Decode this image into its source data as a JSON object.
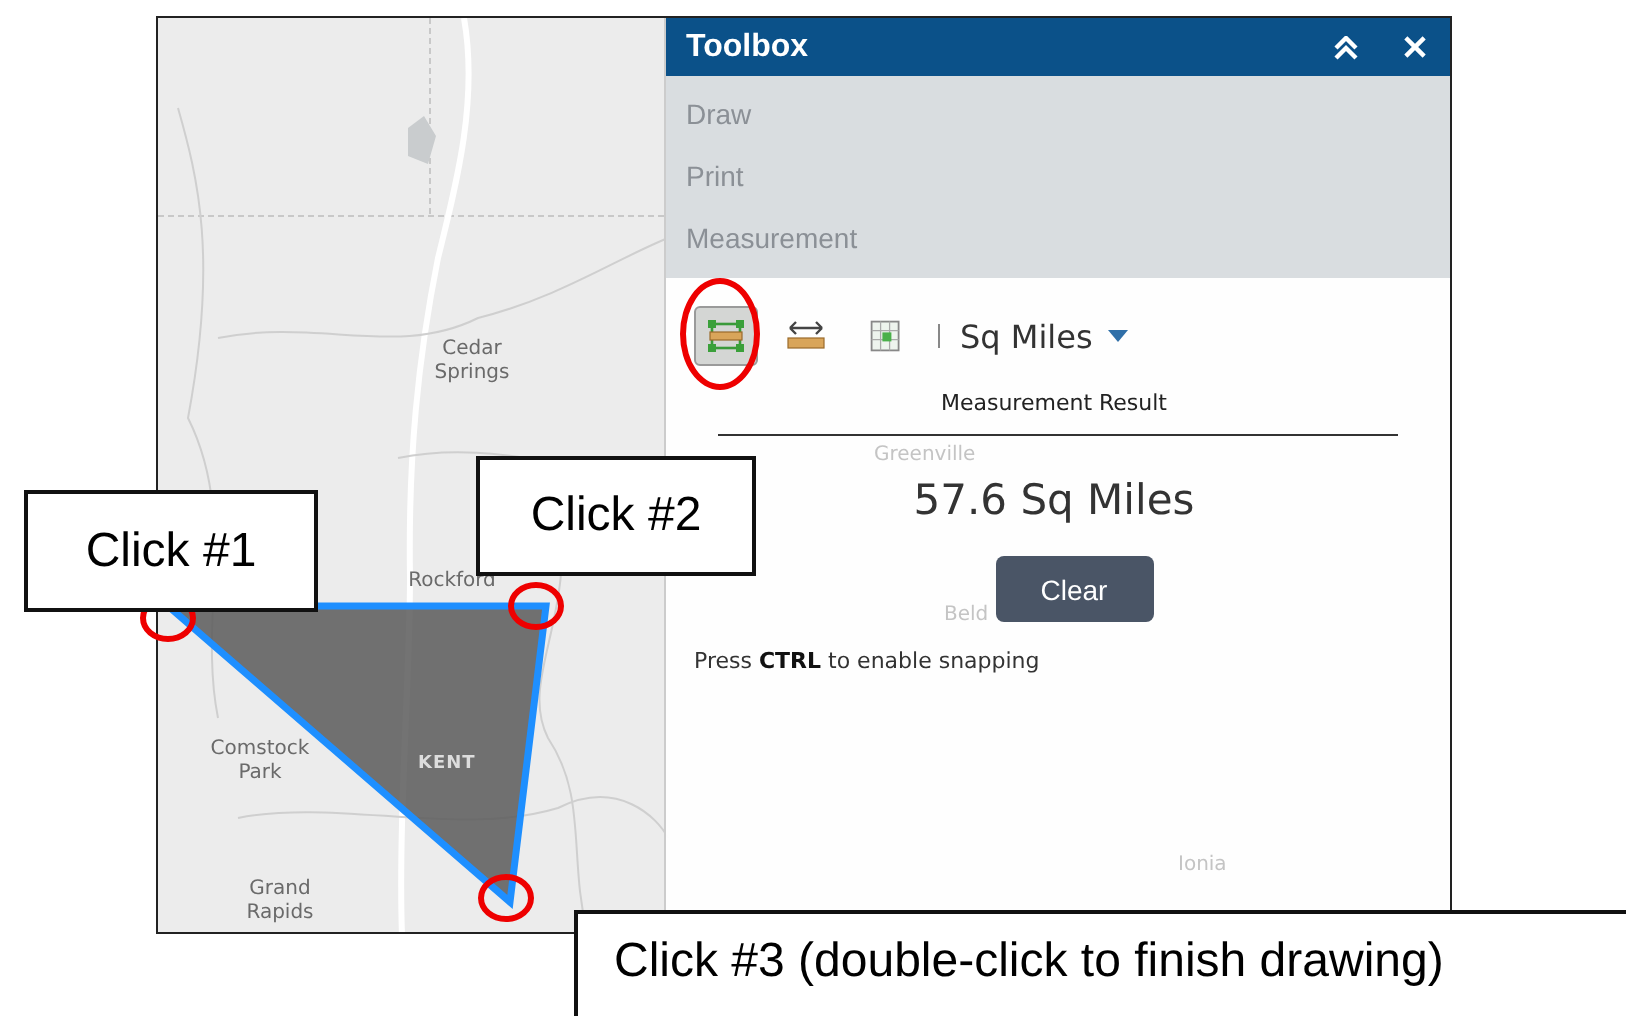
{
  "toolbox": {
    "title": "Toolbox",
    "menu": [
      {
        "label": "Draw"
      },
      {
        "label": "Print"
      },
      {
        "label": "Measurement"
      }
    ],
    "tools": [
      {
        "kind": "area",
        "selected": true
      },
      {
        "kind": "distance",
        "selected": false
      },
      {
        "kind": "location",
        "selected": false
      }
    ],
    "unit": "Sq Miles",
    "result_heading": "Measurement Result",
    "result": "57.6 Sq Miles",
    "clear_button": "Clear",
    "hint": "Press **CTRL** to enable snapping"
  },
  "map": {
    "labels": [
      {
        "text": "Cedar Springs"
      },
      {
        "text": "Rockford"
      },
      {
        "text": "Comstock Park"
      },
      {
        "text": "Grand Rapids"
      },
      {
        "text": "Greenville"
      },
      {
        "text": "Beld"
      },
      {
        "text": "Ionia"
      }
    ],
    "polygon_label": "KENT"
  },
  "callouts": [
    {
      "text": "Click #1"
    },
    {
      "text": "Click #2"
    },
    {
      "text": "Click #3 (double-click to finish drawing)"
    }
  ]
}
